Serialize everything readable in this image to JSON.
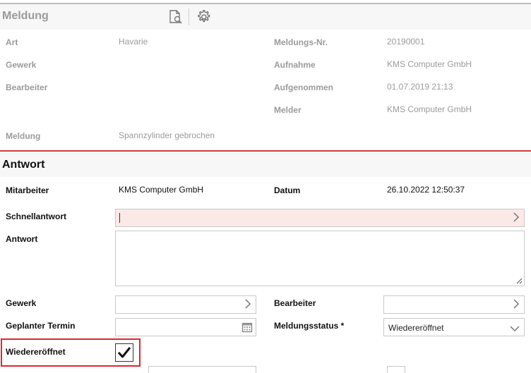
{
  "meldung": {
    "title": "Meldung",
    "fields": {
      "art_label": "Art",
      "art_value": "Havarie",
      "gewerk_label": "Gewerk",
      "bearbeiter_label": "Bearbeiter",
      "meldung_label": "Meldung",
      "meldung_value": "Spannzylinder gebrochen",
      "nr_label": "Meldungs-Nr.",
      "nr_value": "20190001",
      "aufnahme_label": "Aufnahme",
      "aufnahme_value": "KMS Computer GmbH",
      "aufgenommen_label": "Aufgenommen",
      "aufgenommen_value": "01.07.2019 21:13",
      "melder_label": "Melder",
      "melder_value": "KMS Computer GmbH"
    }
  },
  "antwort": {
    "title": "Antwort",
    "mitarbeiter_label": "Mitarbeiter",
    "mitarbeiter_value": "KMS Computer GmbH",
    "datum_label": "Datum",
    "datum_value": "26.10.2022 12:50:37",
    "schnellantwort_label": "Schnellantwort",
    "antwort_label": "Antwort",
    "gewerk_label": "Gewerk",
    "bearbeiter_label": "Bearbeiter",
    "termin_label": "Geplanter Termin",
    "status_label": "Meldungsstatus *",
    "status_value": "Wiedereröffnet",
    "reopened_label": "Wiedereröffnet",
    "reopened_checked": true
  },
  "icons": {
    "doc_search": "document-search-icon",
    "settings": "gear-icon",
    "chevron_right": "chevron-right-icon",
    "chevron_down": "chevron-down-icon",
    "calendar": "calendar-icon",
    "check": "checkmark-icon"
  },
  "colors": {
    "accent_red": "#d33b3b",
    "highlight_red": "#e0262e",
    "quick_answer_bg": "#fbe9e7"
  }
}
